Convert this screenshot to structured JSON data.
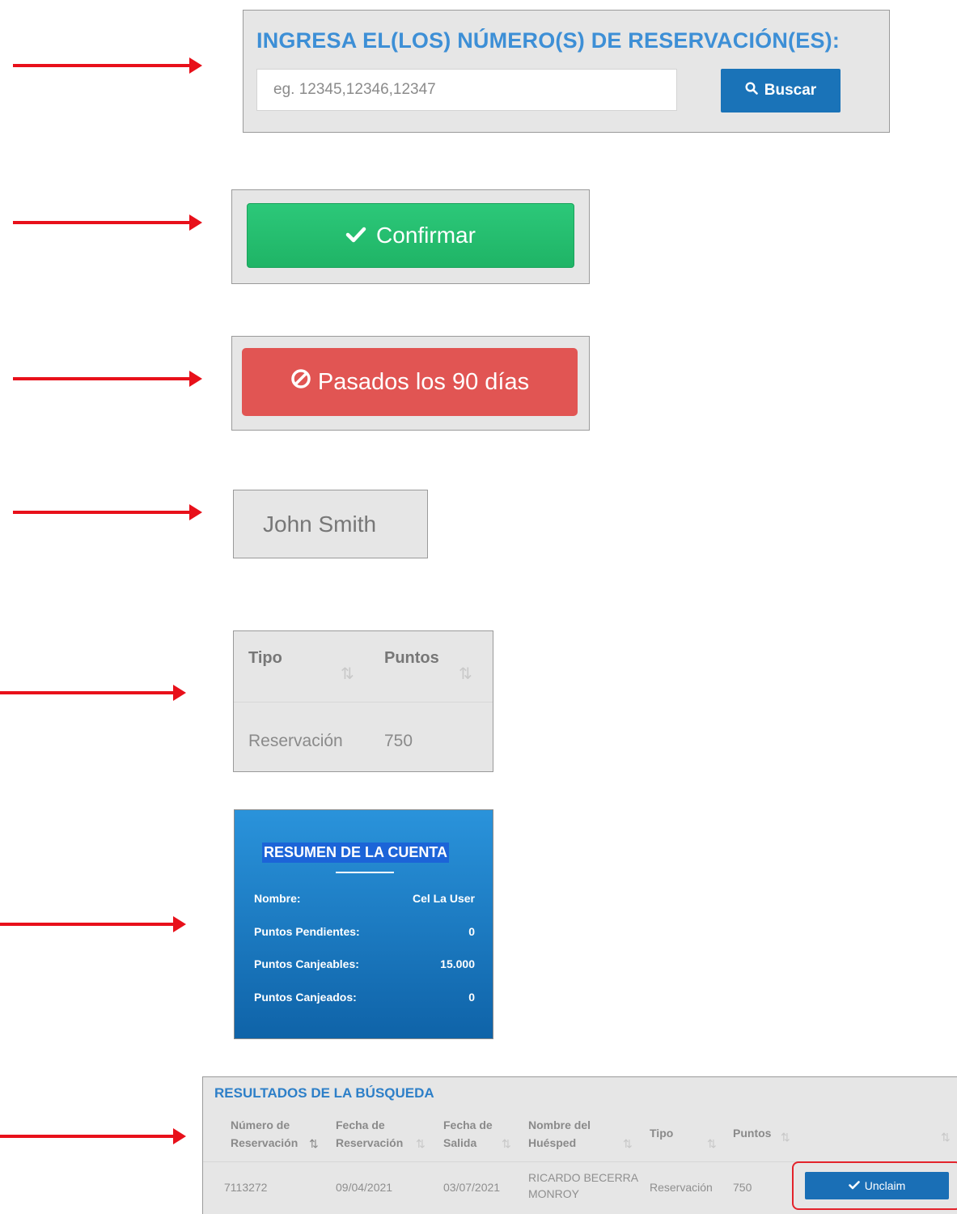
{
  "search": {
    "title": "INGRESA EL(LOS) NÚMERO(S) DE RESERVACIÓN(ES):",
    "placeholder": "eg. 12345,12346,12347",
    "button_label": "Buscar"
  },
  "confirm": {
    "button_label": "Confirmar"
  },
  "past_days": {
    "button_label": "Pasados los 90 días"
  },
  "name_field": {
    "value": "John Smith"
  },
  "mini_table": {
    "headers": [
      "Tipo",
      "Puntos"
    ],
    "row": [
      "Reservación",
      "750"
    ]
  },
  "account": {
    "title": "RESUMEN DE LA CUENTA",
    "rows": [
      {
        "label": "Nombre:",
        "value": "Cel La User"
      },
      {
        "label": "Puntos Pendientes:",
        "value": "0"
      },
      {
        "label": "Puntos Canjeables:",
        "value": "15.000"
      },
      {
        "label": "Puntos Canjeados:",
        "value": "0"
      }
    ]
  },
  "results": {
    "title": "RESULTADOS DE LA BÚSQUEDA",
    "headers": [
      {
        "line1": "Número de",
        "line2": "Reservación"
      },
      {
        "line1": "Fecha de",
        "line2": "Reservación"
      },
      {
        "line1": "Fecha de",
        "line2": "Salida"
      },
      {
        "line1": "Nombre del",
        "line2": "Huésped"
      },
      {
        "line1": "Tipo",
        "line2": ""
      },
      {
        "line1": "Puntos",
        "line2": ""
      }
    ],
    "row": {
      "reservation_number": "7113272",
      "reservation_date": "09/04/2021",
      "checkout_date": "03/07/2021",
      "guest_name_line1": "RICARDO BECERRA",
      "guest_name_line2": "MONROY",
      "type": "Reservación",
      "points": "750",
      "action_label": "Unclaim"
    }
  },
  "colors": {
    "arrow": "#e8101a",
    "accent_blue": "#1a73b8",
    "success_green": "#22bb6d",
    "danger_red": "#e15553"
  }
}
